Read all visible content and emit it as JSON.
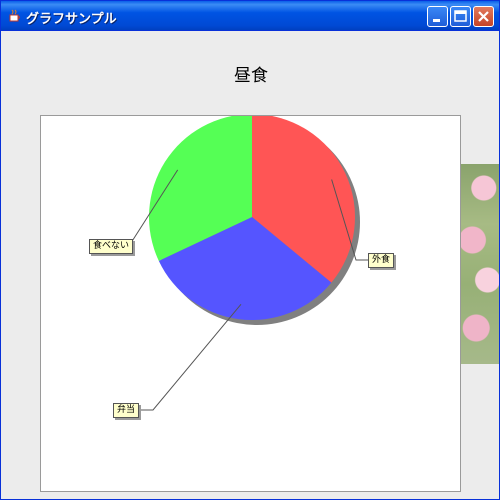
{
  "window": {
    "title": "グラフサンプル"
  },
  "chart_data": {
    "type": "pie",
    "title": "昼食",
    "slices": [
      {
        "label": "外食",
        "value": 36,
        "color": "#ff5555"
      },
      {
        "label": "弁当",
        "value": 32,
        "color": "#5555ff"
      },
      {
        "label": "食べない",
        "value": 32,
        "color": "#55ff55"
      }
    ],
    "shadow_color": "#808080",
    "label_background": "#ffffcc"
  }
}
